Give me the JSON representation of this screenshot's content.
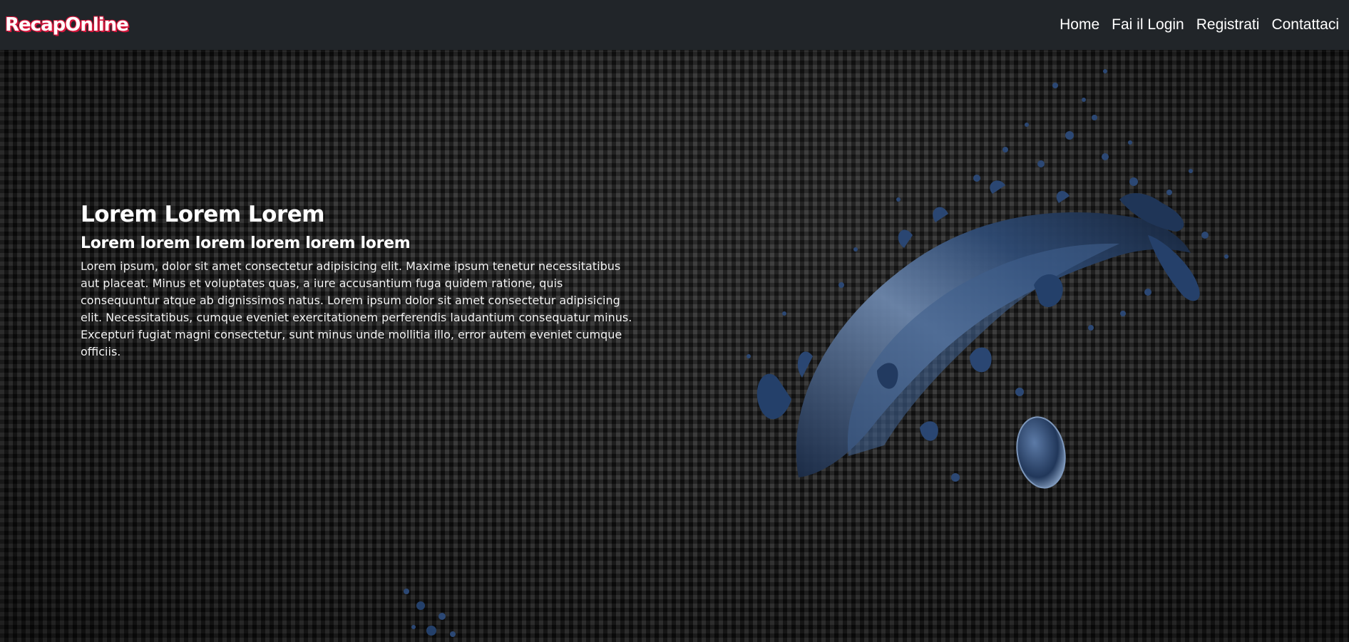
{
  "brand": "RecapOnline",
  "nav": {
    "items": [
      {
        "label": "Home"
      },
      {
        "label": "Fai il Login"
      },
      {
        "label": "Registrati"
      },
      {
        "label": "Contattaci"
      }
    ]
  },
  "hero": {
    "title": "Lorem Lorem Lorem",
    "subtitle": "Lorem lorem lorem lorem lorem lorem",
    "paragraph": "Lorem ipsum, dolor sit amet consectetur adipisicing elit. Maxime ipsum tenetur necessitatibus aut placeat. Minus et voluptates quas, a iure accusantium fuga quidem ratione, quis consequuntur atque ab dignissimos natus. Lorem ipsum dolor sit amet consectetur adipisicing elit. Necessitatibus, cumque eveniet exercitationem perferendis laudantium consequatur minus. Excepturi fugiat magni consectetur, sunt minus unde mollitia illo, error autem eveniet cumque officiis."
  },
  "colors": {
    "navbar_bg": "#212529",
    "brand_shadow": "#d6163c",
    "splash_blue": "#2f4b75"
  },
  "images": {
    "splash": "blue-liquid-splash",
    "background": "carbon-fiber-texture"
  }
}
